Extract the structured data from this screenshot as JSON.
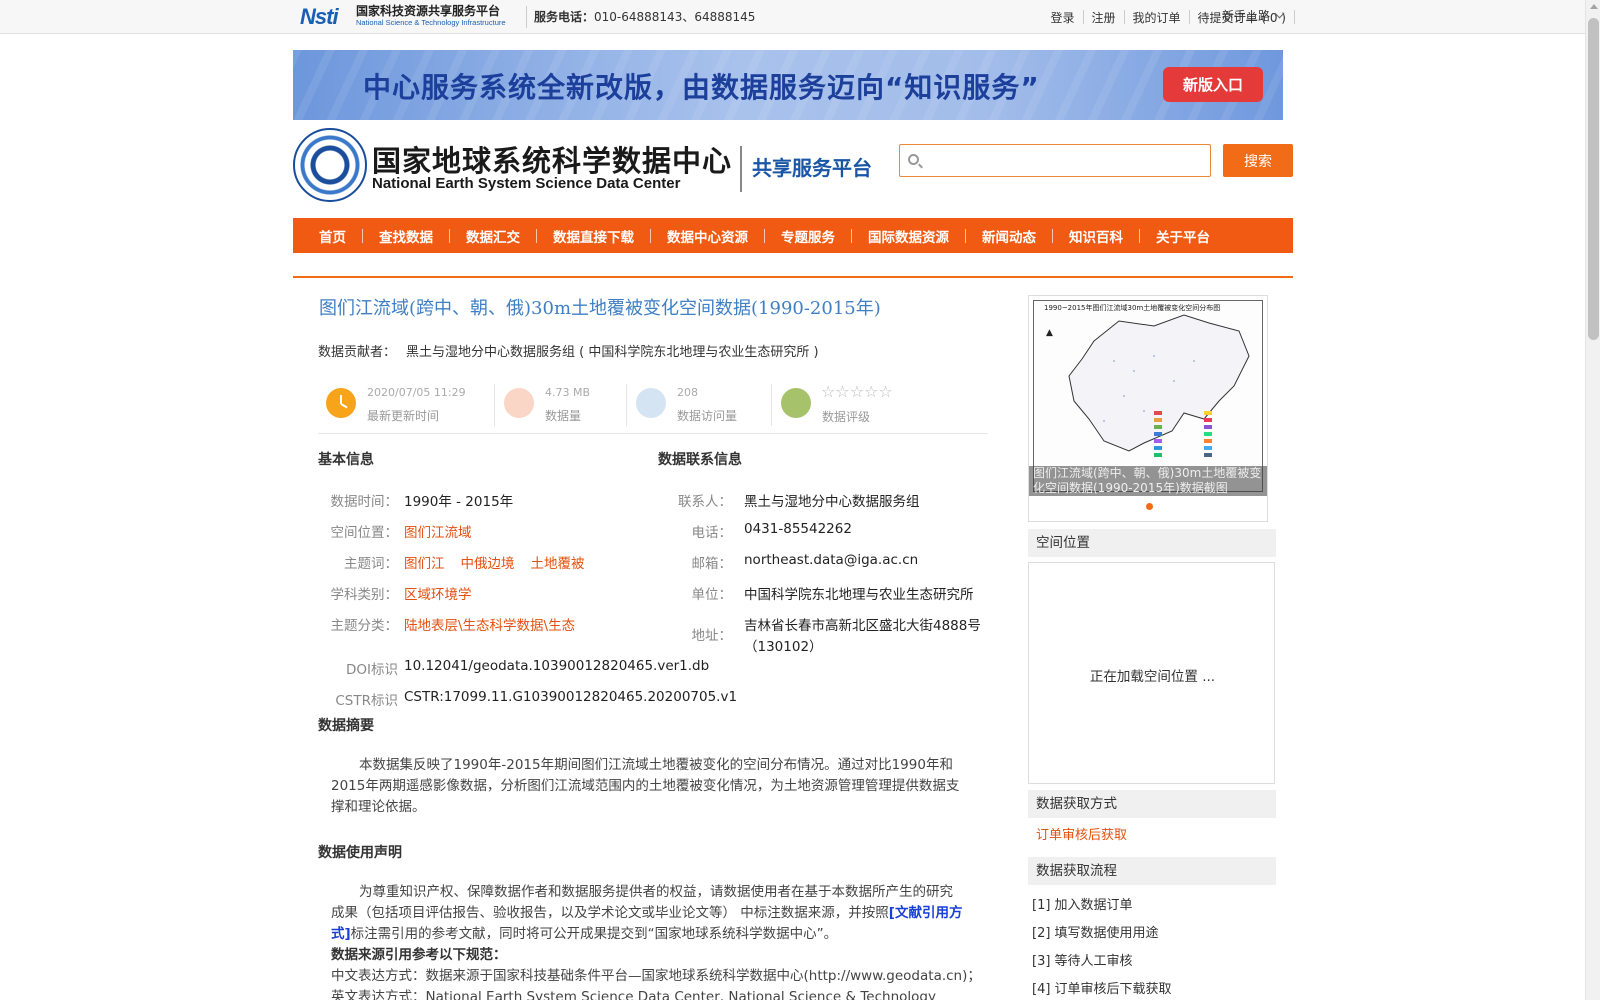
{
  "topbar": {
    "logo_cn": "国家科技资源共享服务平台",
    "logo_en": "National Science & Technology Infrastructure",
    "logo_mark": "Nsti",
    "phone_label": "服务电话：",
    "phone_value": "010-64888143、64888145",
    "links": [
      "登录",
      "注册",
      "我的订单",
      "待提交订单 ( 0 )"
    ],
    "newbie": "新手上路"
  },
  "banner": {
    "text": "中心服务系统全新改版，由数据服务迈向“知识服务”",
    "button": "新版入口"
  },
  "header": {
    "logo_cn": "国家地球系统科学数据中心",
    "logo_en": "National Earth System Science Data Center",
    "platform": "共享服务平台",
    "search_placeholder": "",
    "search_button": "搜索"
  },
  "nav": [
    "首页",
    "查找数据",
    "数据汇交",
    "数据直接下载",
    "数据中心资源",
    "专题服务",
    "国际数据资源",
    "新闻动态",
    "知识百科",
    "关于平台"
  ],
  "dataset": {
    "title": "图们江流域(跨中、朝、俄)30m土地覆被变化空间数据(1990-2015年)",
    "contributor_label": "数据贡献者：",
    "contributor": "黑土与湿地分中心数据服务组 ( 中国科学院东北地理与农业生态研究所 )",
    "stats": {
      "updated_value": "2020/07/05 11:29",
      "updated_label": "最新更新时间",
      "size_value": "4.73 MB",
      "size_label": "数据量",
      "visits_value": "208",
      "visits_label": "数据访问量",
      "rating_stars": "☆☆☆☆☆",
      "rating_label": "数据评级"
    },
    "basic": {
      "heading": "基本信息",
      "time_k": "数据时间：",
      "time_v": "1990年 - 2015年",
      "loc_k": "空间位置：",
      "loc_v": "图们江流域",
      "kw_k": "主题词：",
      "kw": [
        "图们江",
        "中俄边境",
        "土地覆被"
      ],
      "subject_k": "学科类别：",
      "subject_v": "区域环境学",
      "topic_k": "主题分类：",
      "topic_v": "陆地表层\\生态科学数据\\生态",
      "doi_k": "DOI标识",
      "doi_v": "10.12041/geodata.10390012820465.ver1.db",
      "cstr_k": "CSTR标识",
      "cstr_v": "CSTR:17099.11.G10390012820465.20200705.v1"
    },
    "contact": {
      "heading": "数据联系信息",
      "person_k": "联系人：",
      "person_v": "黑土与湿地分中心数据服务组",
      "phone_k": "电话：",
      "phone_v": "0431-85542262",
      "email_k": "邮箱：",
      "email_v": "northeast.data@iga.ac.cn",
      "unit_k": "单位：",
      "unit_v": "中国科学院东北地理与农业生态研究所",
      "addr_k": "地址：",
      "addr_v1": "吉林省长春市高新北区盛北大街4888号",
      "addr_v2": "（130102）"
    },
    "abstract_heading": "数据摘要",
    "abstract_l1": "本数据集反映了1990年-2015年期间图们江流域土地覆被变化的空间分布情况。通过对比1990年和",
    "abstract_l2": "2015年两期遥感影像数据，分析图们江流域范围内的土地覆被变化情况，为土地资源管理管理提供数据支",
    "abstract_l3": "撑和理论依据。",
    "usage_heading": "数据使用声明",
    "usage_l1": "为尊重知识产权、保障数据作者和数据服务提供者的权益，请数据使用者在基于本数据所产生的研究",
    "usage_l2a": "成果（包括项目评估报告、验收报告，以及学术论文或毕业论文等） 中标注数据来源，并按照",
    "usage_link_a": "[文献引用方",
    "usage_link_b": "式]",
    "usage_l3": "标注需引用的参考文献，同时将可公开成果提交到“国家地球系统科学数据中心”。",
    "cite_heading": "数据来源引用参考以下规范：",
    "cite_cn": "中文表达方式：数据来源于国家科技基础条件平台—国家地球系统科学数据中心(http://www.geodata.cn)；",
    "cite_en": "英文表达方式：National Earth System Science Data Center, National Science & Technology"
  },
  "side": {
    "thumb_title": "1990~2015年图们江流域30m土地覆被变化空间分布图",
    "thumb_caption": "图们江流域(跨中、朝、俄)30m土地覆被变化空间数据(1990-2015年)数据截图",
    "spatial_heading": "空间位置",
    "map_loading": "正在加载空间位置 ...",
    "access_heading": "数据获取方式",
    "access_link": "订单审核后获取",
    "flow_heading": "数据获取流程",
    "steps": [
      "[1] 加入数据订单",
      "[2] 填写数据使用用途",
      "[3] 等待人工审核",
      "[4] 订单审核后下载获取"
    ]
  },
  "colors": {
    "accent": "#f15a13",
    "title_blue": "#3f7fc4",
    "link_orange": "#e3500f"
  }
}
